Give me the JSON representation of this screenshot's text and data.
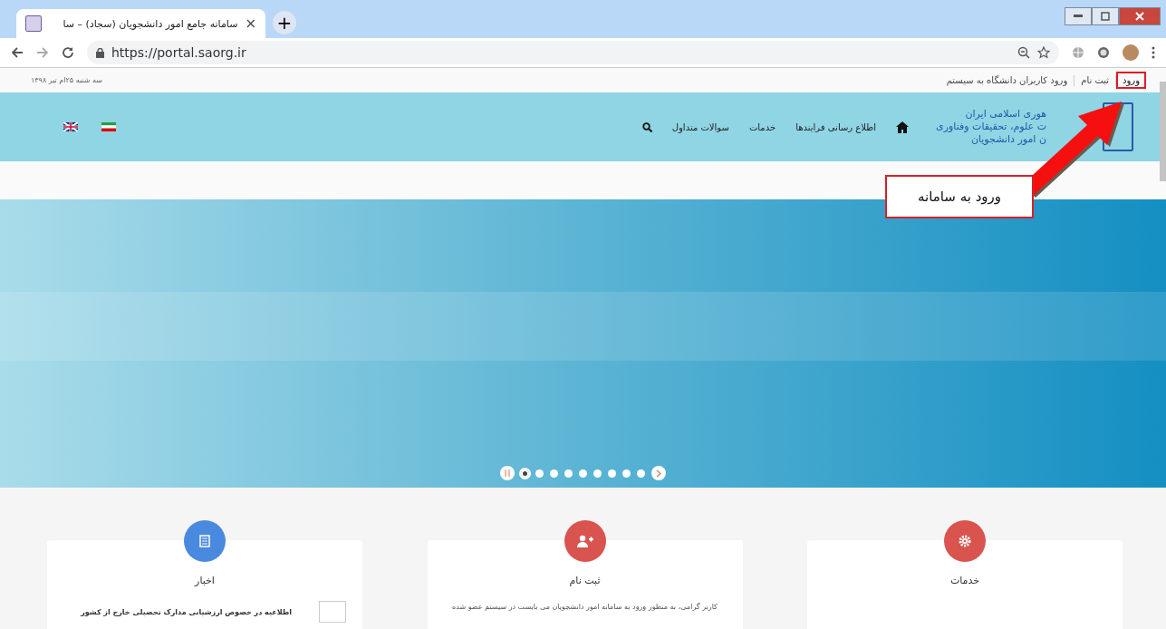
{
  "browser": {
    "tab": {
      "title": "سامانه جامع امور دانشجویان (سجاد) – سا",
      "close": "×",
      "new_tab": "+"
    },
    "url": "https://portal.saorg.ir"
  },
  "topbar": {
    "date": "سه شنبه ۲۵ام تیر ۱۳۹۸",
    "links": [
      {
        "label": "ورود",
        "highlighted": true
      },
      {
        "label": "ثبت نام",
        "highlighted": false
      },
      {
        "label": "ورود کاربران دانشگاه به سیستم",
        "highlighted": false
      }
    ]
  },
  "header": {
    "logo_lines": [
      "هوری اسلامی ایران",
      "ت علوم، تحقیقات وفناوری",
      "ن امور دانشجویان"
    ],
    "nav": [
      "اطلاع رسانی فرایندها",
      "خدمات",
      "سوالات متداول"
    ]
  },
  "callout": {
    "text": "ورود به سامانه"
  },
  "slider": {
    "dots": [
      {
        "selected": true
      },
      {
        "selected": false
      },
      {
        "selected": false
      },
      {
        "selected": false
      },
      {
        "selected": false
      },
      {
        "selected": false
      },
      {
        "selected": false
      },
      {
        "selected": false
      },
      {
        "selected": false
      }
    ]
  },
  "cards": [
    {
      "kind": "gear",
      "title": "خدمات",
      "color": "#d9534f"
    },
    {
      "kind": "user",
      "title": "ثبت نام",
      "color": "#d9534f",
      "text": "کاربر گرامی، به منظور ورود به سامانه امور دانشجویان می بایست در سیستم عضو شده"
    },
    {
      "kind": "news",
      "title": "اخبار",
      "color": "#4a89e0",
      "news": "اطلاعیه در خصوص ارزشیابی مدارک تحصیلی خارج از کشور"
    }
  ]
}
